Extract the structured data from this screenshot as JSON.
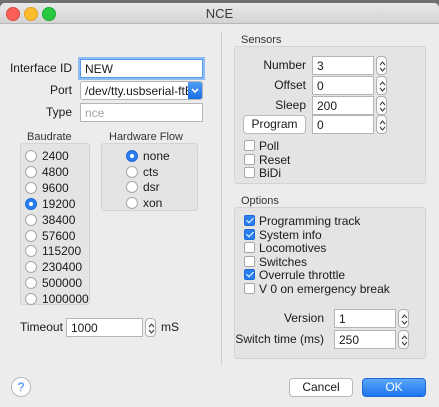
{
  "window": {
    "title": "NCE"
  },
  "interface": {
    "id_label": "Interface ID",
    "id_value": "NEW",
    "port_label": "Port",
    "port_value": "/dev/tty.usbserial-ftEH",
    "type_label": "Type",
    "type_placeholder": "nce"
  },
  "baudrate": {
    "title": "Baudrate",
    "options": [
      "2400",
      "4800",
      "9600",
      "19200",
      "38400",
      "57600",
      "115200",
      "230400",
      "500000",
      "1000000"
    ],
    "selected": "19200"
  },
  "hardware_flow": {
    "title": "Hardware Flow",
    "options": [
      "none",
      "cts",
      "dsr",
      "xon"
    ],
    "selected": "none"
  },
  "timeout": {
    "label": "Timeout",
    "value": "1000",
    "unit": "mS"
  },
  "sensors": {
    "title": "Sensors",
    "number_label": "Number",
    "number_value": "3",
    "offset_label": "Offset",
    "offset_value": "0",
    "sleep_label": "Sleep",
    "sleep_value": "200",
    "program_button": "Program",
    "program_value": "0",
    "checks": [
      {
        "label": "Poll",
        "checked": false
      },
      {
        "label": "Reset",
        "checked": false
      },
      {
        "label": "BiDi",
        "checked": false
      }
    ]
  },
  "options": {
    "title": "Options",
    "checks": [
      {
        "label": "Programming track",
        "checked": true
      },
      {
        "label": "System info",
        "checked": true
      },
      {
        "label": "Locomotives",
        "checked": false
      },
      {
        "label": "Switches",
        "checked": false
      },
      {
        "label": "Overrule throttle",
        "checked": true
      },
      {
        "label": "V 0 on emergency break",
        "checked": false
      }
    ],
    "version_label": "Version",
    "version_value": "1",
    "switch_time_label": "Switch time (ms)",
    "switch_time_value": "250"
  },
  "footer": {
    "help": "?",
    "cancel": "Cancel",
    "ok": "OK"
  },
  "colors": {
    "accent": "#2a7ff0",
    "window_bg": "#ececec",
    "panel_bg": "#e4e4e4"
  },
  "icons": {
    "stepper": "up-down-stepper-icon",
    "combo": "dropdown-arrow-icon",
    "help": "help-icon"
  }
}
